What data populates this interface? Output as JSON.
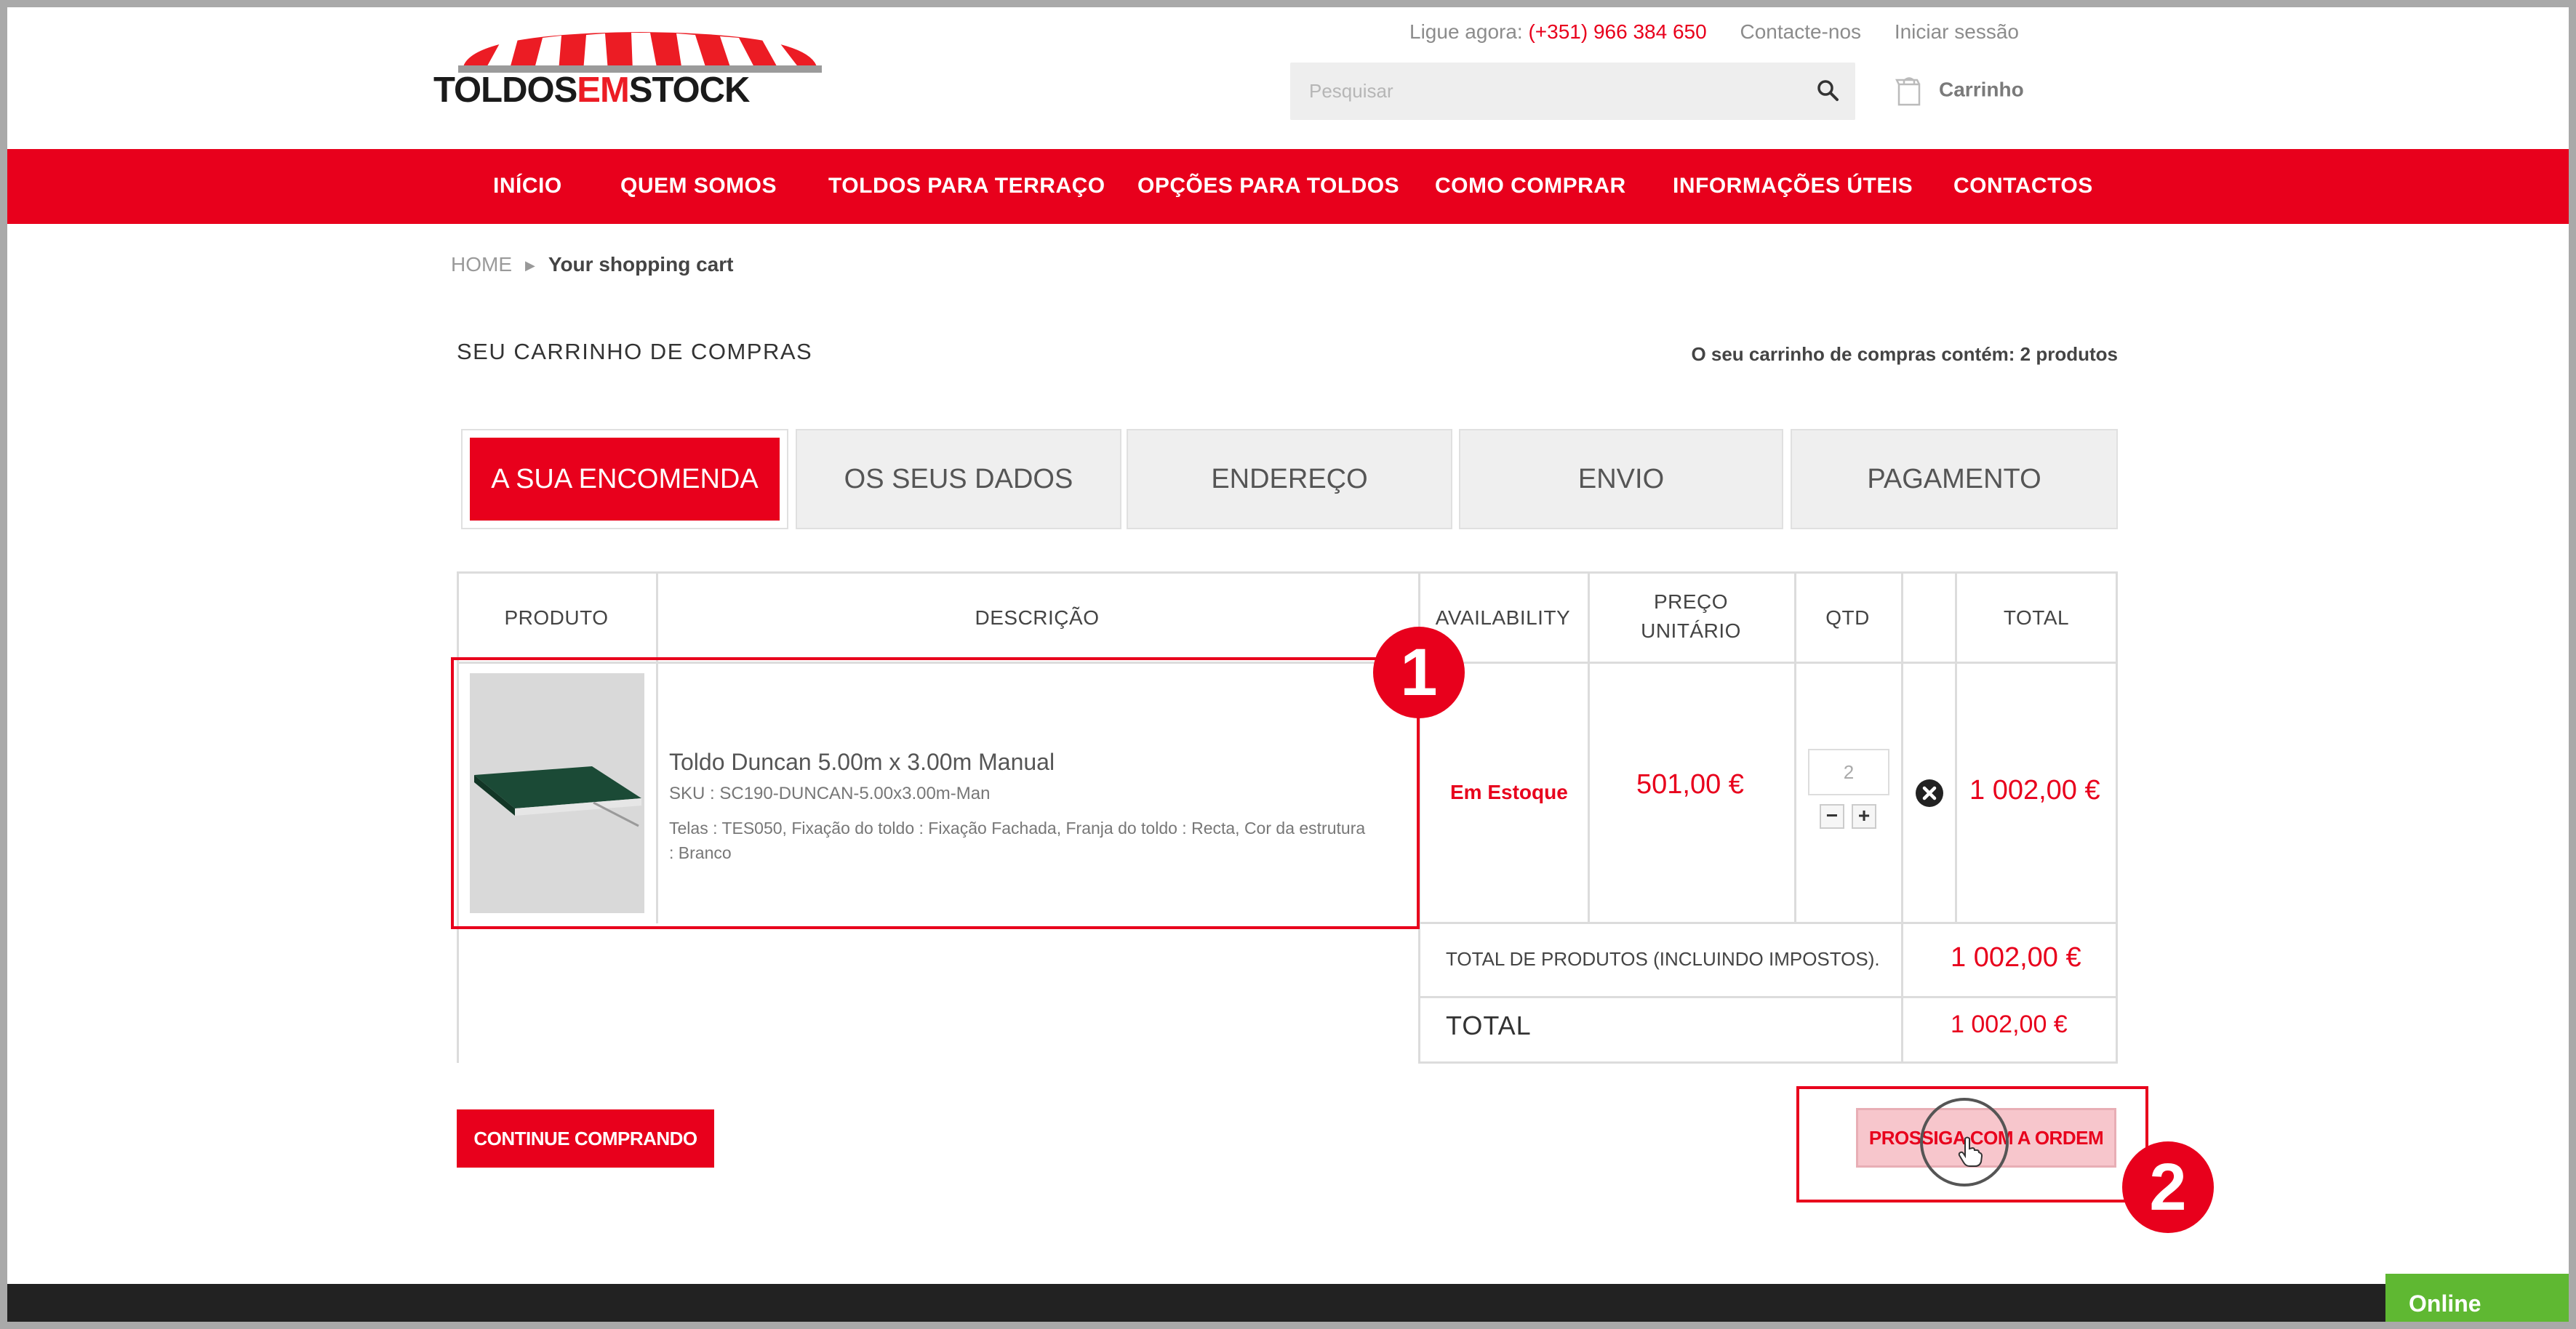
{
  "header": {
    "logo": {
      "prefix": "TOLDOS",
      "accent": "EM",
      "suffix": "STOCK"
    },
    "call_label": "Ligue agora:",
    "phone": "(+351) 966 384 650",
    "contact_link": "Contacte-nos",
    "login_link": "Iniciar sessão",
    "search_placeholder": "Pesquisar",
    "cart_label": "Carrinho"
  },
  "nav": {
    "items": [
      {
        "label": "INÍCIO"
      },
      {
        "label": "QUEM SOMOS"
      },
      {
        "label": "TOLDOS PARA TERRAÇO"
      },
      {
        "label": "OPÇÕES PARA TOLDOS"
      },
      {
        "label": "COMO COMPRAR"
      },
      {
        "label": "INFORMAÇÕES ÚTEIS"
      },
      {
        "label": "CONTACTOS"
      }
    ]
  },
  "breadcrumb": {
    "home": "HOME",
    "current": "Your shopping cart"
  },
  "page": {
    "title": "SEU CARRINHO DE COMPRAS",
    "count": "O seu carrinho de compras contém: 2 produtos"
  },
  "steps": [
    {
      "label": "A SUA ENCOMENDA",
      "active": true
    },
    {
      "label": "OS SEUS DADOS",
      "active": false
    },
    {
      "label": "ENDEREÇO",
      "active": false
    },
    {
      "label": "ENVIO",
      "active": false
    },
    {
      "label": "PAGAMENTO",
      "active": false
    }
  ],
  "table": {
    "headers": {
      "produto": "PRODUTO",
      "descricao": "DESCRIÇÃO",
      "availability": "AVAILABILITY",
      "preco_1": "PREÇO",
      "preco_2": "UNITÁRIO",
      "qtd": "QTD",
      "total": "TOTAL"
    },
    "row": {
      "name": "Toldo Duncan 5.00m x 3.00m Manual",
      "sku": "SKU : SC190-DUNCAN-5.00x3.00m-Man",
      "options": "Telas : TES050, Fixação do toldo : Fixação Fachada, Franja do toldo : Recta, Cor da estrutura : Branco",
      "availability": "Em Estoque",
      "unit_price": "501,00 €",
      "qty": "2",
      "total": "1 002,00 €"
    },
    "summary": {
      "products_label": "TOTAL DE PRODUTOS (INCLUINDO IMPOSTOS).",
      "products_value": "1 002,00 €",
      "total_label": "TOTAL",
      "total_value": "1 002,00 €"
    }
  },
  "buttons": {
    "continue": "CONTINUE COMPRANDO",
    "proceed": "PROSSIGA COM A ORDEM"
  },
  "annotations": {
    "badge_1": "1",
    "badge_2": "2"
  },
  "chat": {
    "status": "Online"
  },
  "colors": {
    "brand_red": "#e8001c",
    "online_green": "#5fb832"
  }
}
